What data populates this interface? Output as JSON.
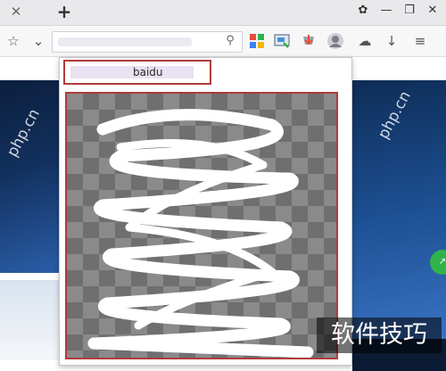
{
  "tabbar": {
    "close_icon": "close-icon",
    "new_tab_icon": "plus-icon",
    "window_controls": [
      "settings-icon",
      "minimize-icon",
      "restore-icon",
      "close-window-icon"
    ]
  },
  "toolbar": {
    "buttons": [
      "star-icon",
      "chevron-down-icon",
      "search-icon",
      "app-grid-icon",
      "screenshot-icon",
      "download-helper-icon",
      "user-avatar-icon",
      "cloud-icon",
      "download-icon",
      "menu-icon"
    ]
  },
  "popup": {
    "header_text": "baidu"
  },
  "watermark": {
    "text": "软件技巧",
    "side_text": "php.cn"
  },
  "colors": {
    "highlight_border": "#b13b3b",
    "banner_blue": "#1c4f92",
    "green_badge": "#2fb34a"
  }
}
